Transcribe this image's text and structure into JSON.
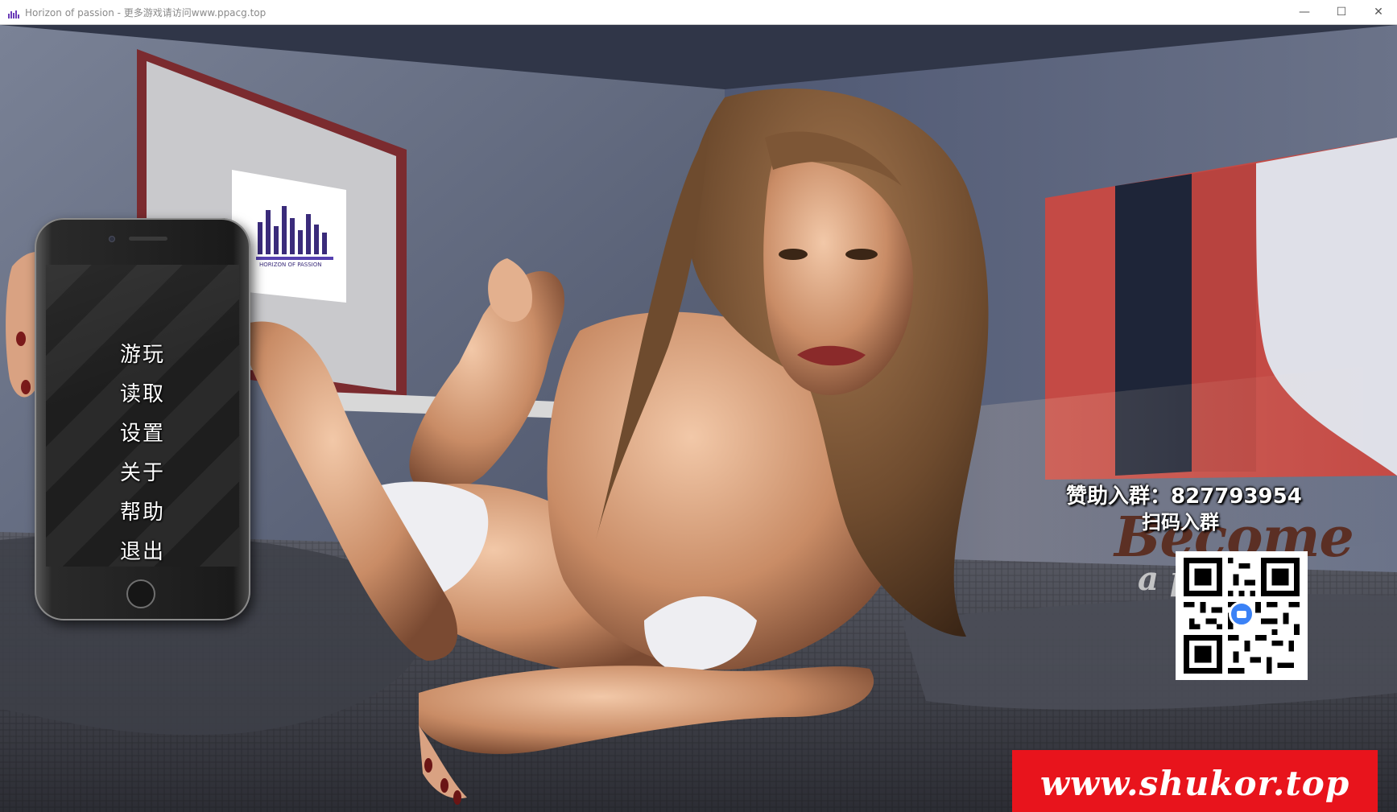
{
  "window": {
    "title": "Horizon of passion - 更多游戏请访问www.ppacg.top",
    "controls": {
      "minimize": "—",
      "maximize": "☐",
      "close": "✕"
    }
  },
  "main_menu": {
    "items": [
      {
        "label": "游玩"
      },
      {
        "label": "读取"
      },
      {
        "label": "设置"
      },
      {
        "label": "关于"
      },
      {
        "label": "帮助"
      },
      {
        "label": "退出"
      }
    ]
  },
  "scene": {
    "poster_text": "HORIZON OF PASSION"
  },
  "promo": {
    "group": "赞助入群：827793954",
    "scan": "扫码入群",
    "become": "Become",
    "patron": "a patron",
    "site": "www.shukor.top"
  },
  "colors": {
    "wall": "#56607a",
    "banner": "#e8141c",
    "phone_body": "#1a1a1a"
  }
}
